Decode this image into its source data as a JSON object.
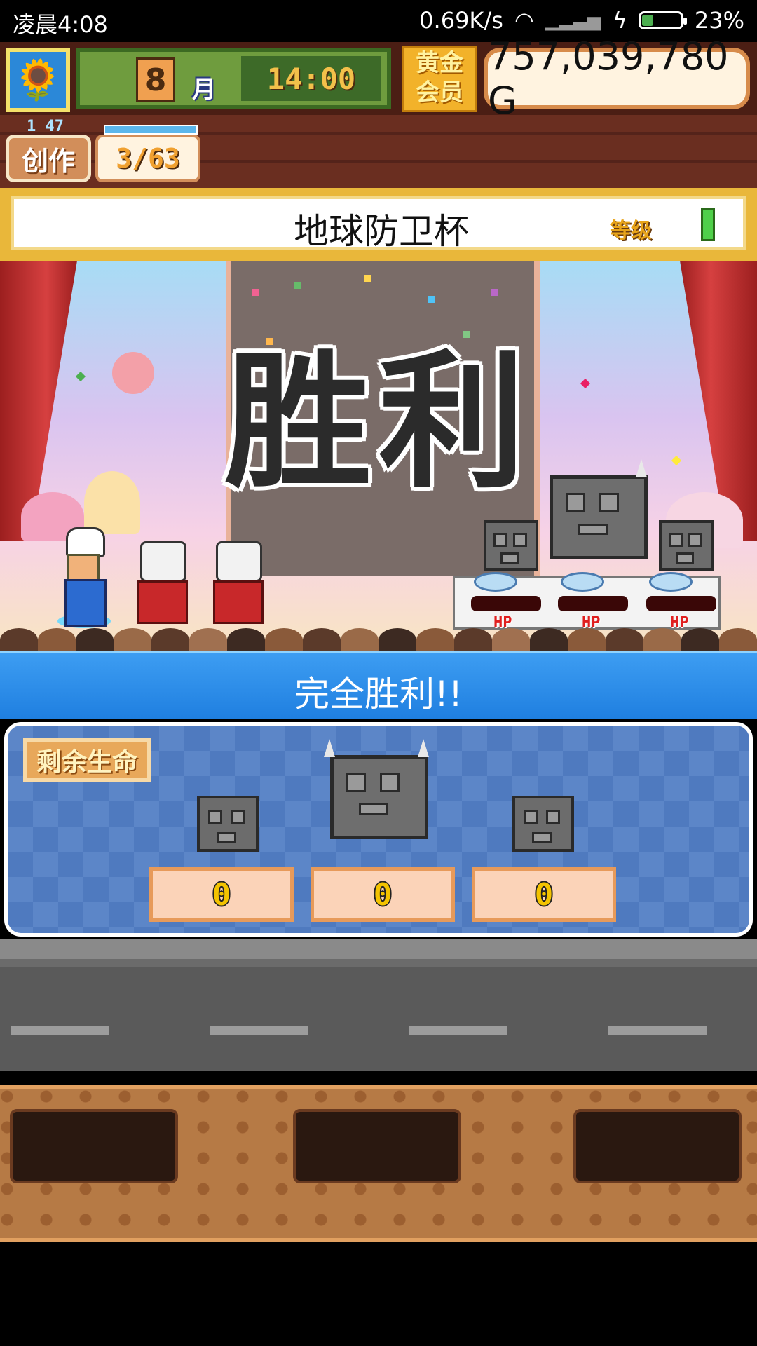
{
  "status_bar": {
    "time": "凌晨4:08",
    "speed": "0.69K/s",
    "battery": "23%"
  },
  "hud": {
    "month": "8",
    "month_unit": "月",
    "clock": "14:00",
    "member_line1": "黄金",
    "member_line2": "会员",
    "money": "757,039,780 G",
    "create_label": "创作",
    "create_count": "3/63",
    "create_top_num": "1 47"
  },
  "tournament": {
    "name": "地球防卫杯",
    "rank": "等级"
  },
  "stage": {
    "victory_text": "胜利",
    "hp_label": "HP"
  },
  "result": {
    "title": "完全胜利!!",
    "remaining_label": "剩余生命",
    "lives": [
      "0",
      "0",
      "0"
    ]
  },
  "colors": {
    "header_blue": "#1f7fe0",
    "money_border": "#d78b4b",
    "gold": "#f2b22a"
  }
}
